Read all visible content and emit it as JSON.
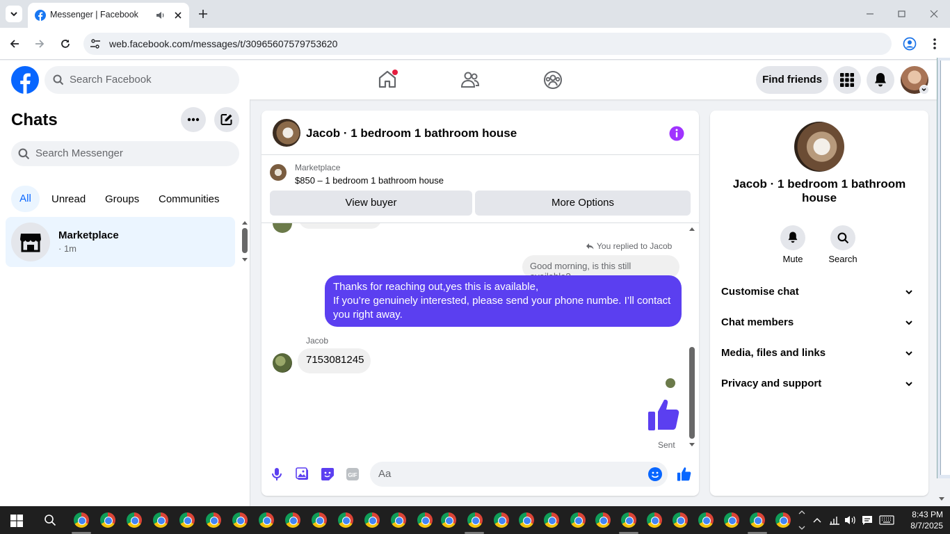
{
  "browser": {
    "tab_title": "Messenger | Facebook",
    "url": "web.facebook.com/messages/t/30965607579753620"
  },
  "header": {
    "search_placeholder": "Search Facebook",
    "find_friends_label": "Find friends"
  },
  "left": {
    "title": "Chats",
    "search_placeholder": "Search Messenger",
    "filters": [
      "All",
      "Unread",
      "Groups",
      "Communities"
    ],
    "active_filter": "All",
    "chats": [
      {
        "name": "Marketplace",
        "meta": "· 1m"
      }
    ]
  },
  "chat": {
    "title": "Jacob · 1 bedroom 1 bathroom house",
    "marketplace_label": "Marketplace",
    "listing": "$850 – 1 bedroom 1 bathroom house",
    "view_buyer_label": "View buyer",
    "more_options_label": "More Options",
    "replied_label": "You replied to Jacob",
    "quoted_message": "Good morning, is this still available?",
    "outgoing_message": "Thanks for reaching out,yes this is  available,\nIf you’re genuinely interested, please send your phone numbe. I’ll contact you right away.",
    "sender_name": "Jacob",
    "incoming_message": "7153081245",
    "sent_status": "Sent",
    "composer_placeholder": "Aa",
    "accent_color": "#5b3ff0"
  },
  "info": {
    "name": "Jacob · 1 bedroom 1 bathroom house",
    "mute_label": "Mute",
    "search_label": "Search",
    "sections": [
      "Customise chat",
      "Chat members",
      "Media, files and links",
      "Privacy and support"
    ]
  },
  "taskbar": {
    "time": "8:43 PM",
    "date": "8/7/2025"
  }
}
